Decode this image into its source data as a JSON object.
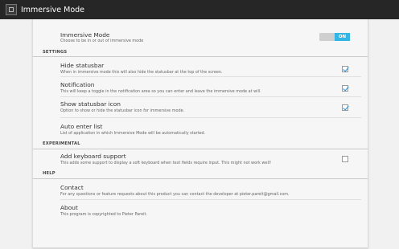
{
  "app": {
    "title": "Immersive Mode",
    "icon": "immersive-mode-app-icon"
  },
  "immersive": {
    "title": "Immersive Mode",
    "summary": "Choose to be in or out of immersive mode",
    "toggle_label": "ON",
    "toggle_state": true,
    "accent_color": "#33b5e5"
  },
  "sections": {
    "settings": "SETTINGS",
    "experimental": "EXPERIMENTAL",
    "help": "HELP"
  },
  "settings": {
    "hide_statusbar": {
      "title": "Hide statusbar",
      "summary": "When in immersive mode this will also hide the statusbar at the top of the screen.",
      "checked": true
    },
    "notification": {
      "title": "Notification",
      "summary": "This will keep a toggle in the notification area so you can enter and leave the immersive mode at will.",
      "checked": true
    },
    "show_statusbar_icon": {
      "title": "Show statusbar icon",
      "summary": "Option to show or hide the statusbar icon for immersive mode.",
      "checked": true
    },
    "auto_enter_list": {
      "title": "Auto enter list",
      "summary": "List of application in which Immersive Mode will be automatically started."
    }
  },
  "experimental": {
    "keyboard_support": {
      "title": "Add keyboard support",
      "summary": "This adds some support to display a soft keyboard when text fields require input. This might not work well!",
      "checked": false
    }
  },
  "help": {
    "contact": {
      "title": "Contact",
      "summary": "For any questions or feature requests about this product you can contact the developer at pieter.pareit@gmail.com."
    },
    "about": {
      "title": "About",
      "summary": "This program is copyrighted to Pieter Pareit."
    }
  }
}
